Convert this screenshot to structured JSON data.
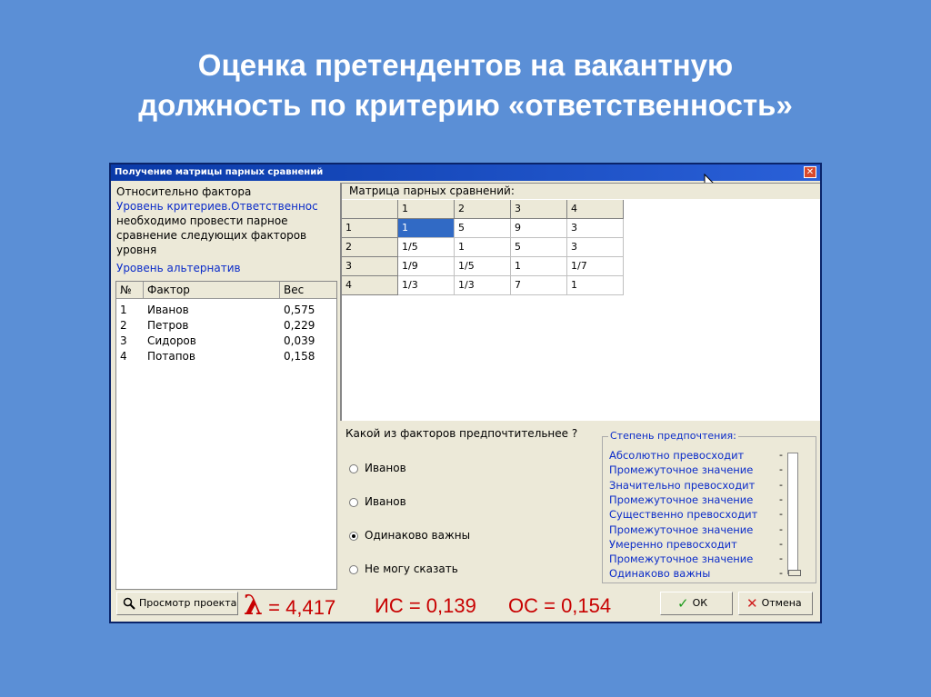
{
  "slide_title": {
    "line1": "Оценка претендентов на вакантную",
    "line2": "должность по  критерию «ответственность»"
  },
  "window": {
    "title": "Получение матрицы парных сравнений",
    "close_icon": "close-x"
  },
  "left_info": {
    "label": "Относительно фактора",
    "criteria_link": "Уровень критериев.Ответственнос",
    "instruction": "необходимо провести парное сравнение следующих факторов уровня",
    "alternatives_link": "Уровень альтернатив"
  },
  "factors": {
    "headers": [
      "№",
      "Фактор",
      "Вес"
    ],
    "rows": [
      {
        "num": "1",
        "name": "Иванов",
        "weight": "0,575"
      },
      {
        "num": "2",
        "name": "Петров",
        "weight": "0,229"
      },
      {
        "num": "3",
        "name": "Сидоров",
        "weight": "0,039"
      },
      {
        "num": "4",
        "name": "Потапов",
        "weight": "0,158"
      }
    ]
  },
  "matrix": {
    "caption": "Матрица парных сравнений:",
    "col_headers": [
      "1",
      "2",
      "3",
      "4"
    ],
    "row_headers": [
      "1",
      "2",
      "3",
      "4"
    ],
    "cells": [
      [
        "1",
        "5",
        "9",
        "3"
      ],
      [
        "1/5",
        "1",
        "5",
        "3"
      ],
      [
        "1/9",
        "1/5",
        "1",
        "1/7"
      ],
      [
        "1/3",
        "1/3",
        "7",
        "1"
      ]
    ],
    "selected": [
      0,
      0
    ]
  },
  "question": {
    "text": "Какой из факторов предпочтительнее ?",
    "options": [
      {
        "label": "Иванов",
        "checked": false
      },
      {
        "label": "Иванов",
        "checked": false
      },
      {
        "label": "Одинаково важны",
        "checked": true
      },
      {
        "label": "Не могу сказать",
        "checked": false
      }
    ]
  },
  "preference": {
    "title": "Степень предпочтения:",
    "items": [
      "Абсолютно превосходит",
      "Промежуточное значение",
      "Значительно превосходит",
      "Промежуточное значение",
      "Существенно превосходит",
      "Промежуточное значение",
      "Умеренно превосходит",
      "Промежуточное значение",
      "Одинаково важны"
    ],
    "dash": "-",
    "selected_index": 8
  },
  "buttons": {
    "preview": "Просмотр проекта",
    "ok": "ОК",
    "cancel": "Отмена"
  },
  "stats": {
    "lambda_symbol": "λ",
    "lambda_value": "= 4,417",
    "ci": "ИС = 0,139",
    "cr": "ОС = 0,154"
  },
  "colors": {
    "background": "#5b8fd6",
    "link_blue": "#0b2cc9",
    "stats_red": "#c80000",
    "selection": "#316ac5"
  }
}
